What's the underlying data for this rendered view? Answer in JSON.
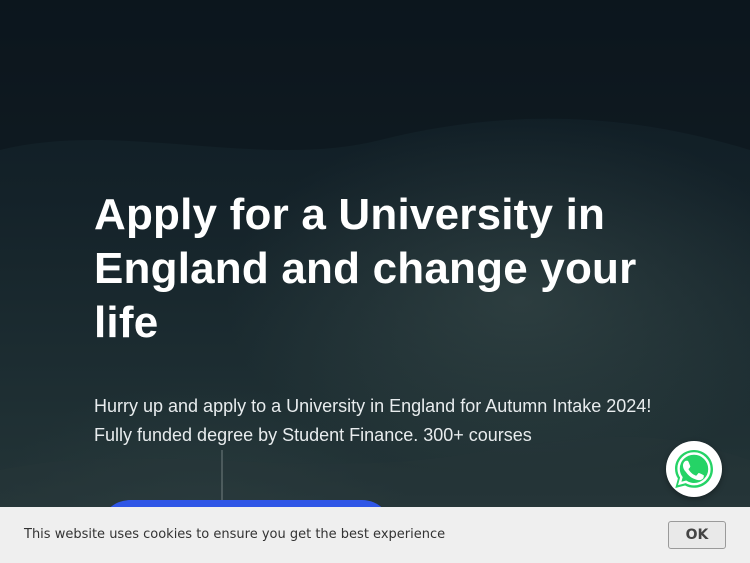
{
  "hero": {
    "title": "Apply for a University in England and change your life",
    "subtitle": "Hurry up and apply to a University in England for Autumn Intake 2024! Fully funded degree by Student Finance. 300+ courses"
  },
  "cta": {
    "label": ""
  },
  "whatsapp": {
    "icon": "whatsapp-icon",
    "color": "#25d366"
  },
  "cookie_banner": {
    "message": "This website uses cookies to ensure you get the best experience",
    "ok_label": "OK"
  },
  "colors": {
    "cta_blue": "#2f56e6",
    "hero_dark": "#0f1a22",
    "cookie_bg": "#efefef"
  }
}
